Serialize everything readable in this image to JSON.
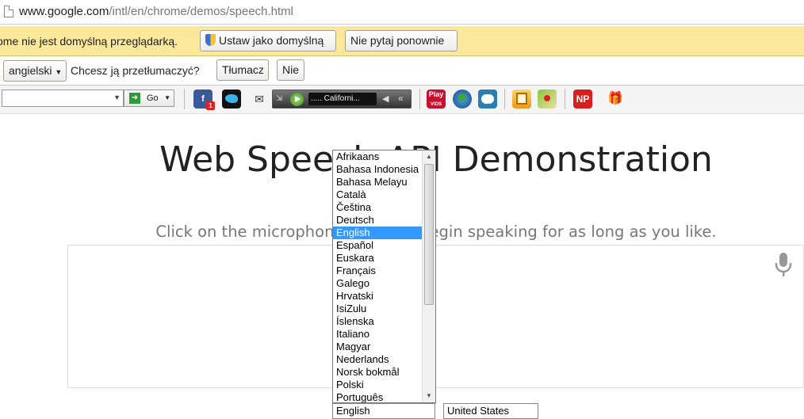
{
  "address_bar": {
    "url_host": "www.google.com",
    "url_path": "/intl/en/chrome/demos/speech.html"
  },
  "default_infobar": {
    "message": "ome nie jest domyślną przeglądarką.",
    "set_default_label": "Ustaw jako domyślną",
    "dont_ask_label": "Nie pytaj ponownie"
  },
  "translate_bar": {
    "language": "angielski",
    "question": "Chcesz ją przetłumaczyć?",
    "translate_label": "Tłumacz",
    "no_label": "Nie"
  },
  "toolbar": {
    "go_label": "Go",
    "radio_station": "..... Californi...",
    "icons": [
      "facebook-icon",
      "twitter-icon",
      "mail-icon",
      "radio-icon",
      "play-vids-icon",
      "weather-icon",
      "games-icon",
      "calculator-icon",
      "maps-icon",
      "news-icon",
      "gift-icon"
    ],
    "play_vids_text": "Play",
    "news_text": "NP"
  },
  "page": {
    "title": "Web Speech API Demonstration",
    "instructions": "Click on the microphone icon and begin speaking for as long as you like."
  },
  "language_dropdown": {
    "items": [
      "Afrikaans",
      "Bahasa Indonesia",
      "Bahasa Melayu",
      "Català",
      "Čeština",
      "Deutsch",
      "English",
      "Español",
      "Euskara",
      "Français",
      "Galego",
      "Hrvatski",
      "IsiZulu",
      "Íslenska",
      "Italiano",
      "Magyar",
      "Nederlands",
      "Norsk bokmål",
      "Polski",
      "Português"
    ],
    "selected": "English"
  },
  "language_select_value": "English",
  "dialect_select_value": "United States",
  "colors": {
    "infobar": "#fbe89a",
    "selected": "#3399ff"
  }
}
